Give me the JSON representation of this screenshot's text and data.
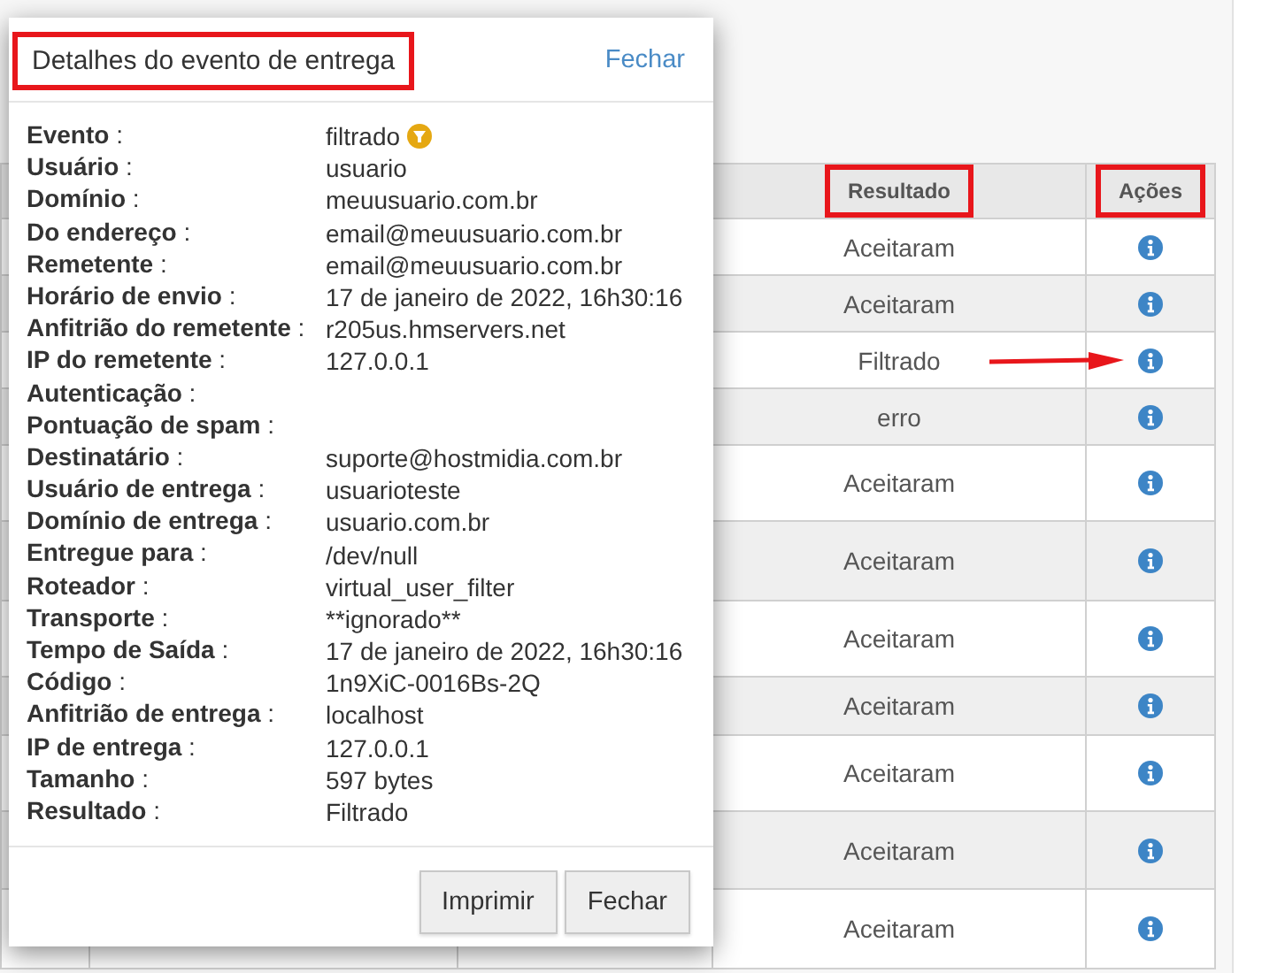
{
  "background_table": {
    "columns": [
      {
        "label": "Resultado",
        "highlighted": true
      },
      {
        "label": "Ações",
        "highlighted": true
      }
    ],
    "rows": [
      {
        "result": "Aceitaram",
        "marked": false
      },
      {
        "result": "Aceitaram",
        "marked": false
      },
      {
        "result": "Filtrado",
        "marked": true
      },
      {
        "result": "erro",
        "marked": false
      },
      {
        "result": "Aceitaram",
        "marked": false
      },
      {
        "result": "Aceitaram",
        "marked": false
      },
      {
        "result": "Aceitaram",
        "marked": false
      },
      {
        "result": "Aceitaram",
        "marked": false
      },
      {
        "result": "Aceitaram",
        "marked": false
      },
      {
        "result": "Aceitaram",
        "marked": false
      },
      {
        "result": "Aceitaram",
        "marked": false
      }
    ]
  },
  "dialog": {
    "title": "Detalhes do evento de entrega",
    "title_highlighted": true,
    "close_link": "Fechar",
    "fields": [
      {
        "label": "**Evento** :",
        "value": "filtrado",
        "kind": "filtered"
      },
      {
        "label": "**Usuário** :",
        "value": "usuario"
      },
      {
        "label": "**Domínio** :",
        "value": "meuusuario.com.br"
      },
      {
        "label": "**Do endereço** :",
        "value": "email@meuusuario.com.br"
      },
      {
        "label": "**Remetente** :",
        "value": "email@meuusuario.com.br"
      },
      {
        "label": "**Horário de envio** :",
        "value": "17 de janeiro de 2022, 16h30:16"
      },
      {
        "label": "**Anfitrião do remetente** :",
        "value": "r205us.hmservers.net"
      },
      {
        "label": "**IP do remetente** :",
        "value": "127.0.0.1"
      },
      {
        "label": "**Autenticação** :"
      },
      {
        "label": "**Pontuação de spam** :"
      },
      {
        "label": "**Destinatário** :",
        "value": "suporte@hostmidia.com.br"
      },
      {
        "label": "**Usuário de entrega** :",
        "value": "usuarioteste"
      },
      {
        "label": "**Domínio de entrega** :",
        "value": "usuario.com.br"
      },
      {
        "label": "**Entregue para** :",
        "value": "/dev/null"
      },
      {
        "label": "**Roteador** :",
        "value": "virtual_user_filter"
      },
      {
        "label": "**Transporte** :",
        "value": "**ignorado**"
      },
      {
        "label": "**Tempo de Saída** :",
        "value": "17 de janeiro de 2022, 16h30:16"
      },
      {
        "label": "**Código** :",
        "value": "1n9XiC-0016Bs-2Q"
      },
      {
        "label": "**Anfitrião de entrega** :",
        "value": "localhost"
      },
      {
        "label": "**IP de entrega** :",
        "value": "127.0.0.1"
      },
      {
        "label": "**Tamanho** :",
        "value": "597 bytes"
      },
      {
        "label": "**Resultado** :",
        "value": "Filtrado"
      }
    ],
    "buttons": [
      "Imprimir",
      "Fechar"
    ]
  }
}
